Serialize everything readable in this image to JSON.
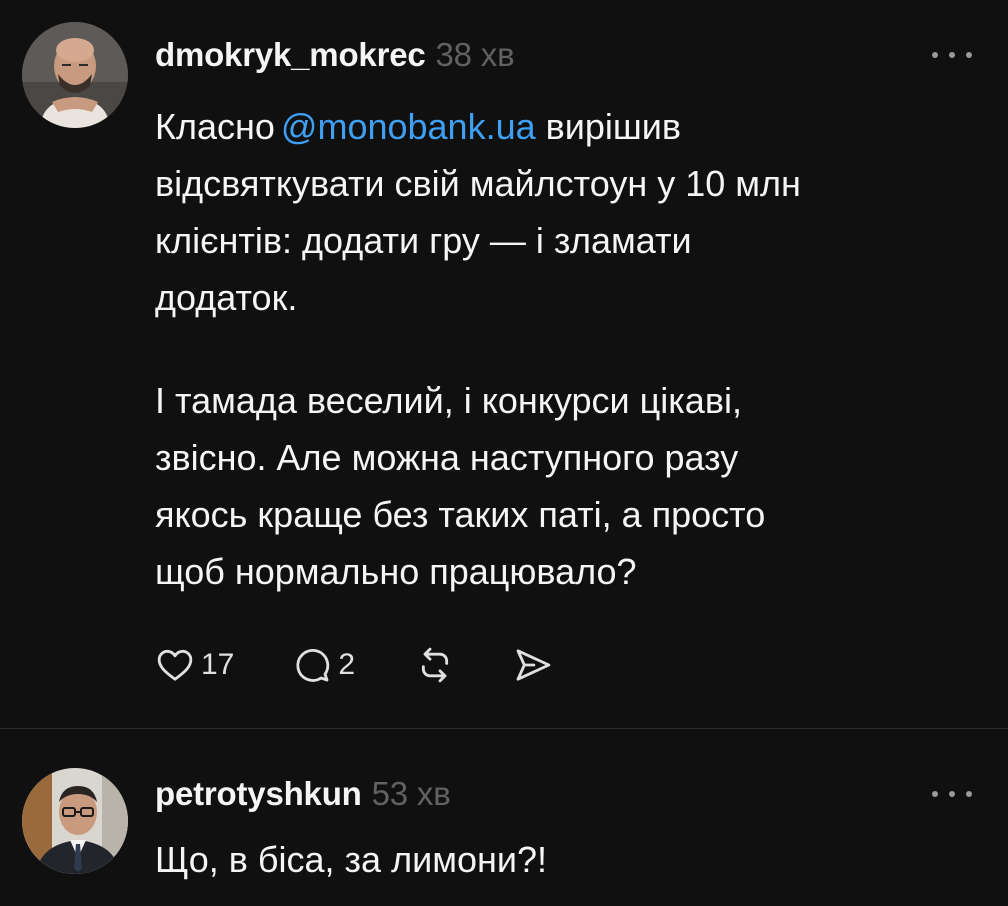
{
  "posts": [
    {
      "username": "dmokryk_mokrec",
      "time": "38 хв",
      "avatar_icon": "bald-man-avatar",
      "text": {
        "prefix": "Класно",
        "mention": "@monobank.ua",
        "line1_suffix": " вирішив",
        "line2": "відсвяткувати свій майлстоун у 10 млн",
        "line3": "клієнтів: додати гру — і зламати",
        "line4": "додаток.",
        "p2_line1": "І тамада веселий, і конкурси цікаві,",
        "p2_line2": "звісно. Але можна наступного разу",
        "p2_line3": "якось краще без таких паті, а просто",
        "p2_line4": "щоб нормально працювало?"
      },
      "likes": "17",
      "replies": "2"
    },
    {
      "username": "petrotyshkun",
      "time": "53 хв",
      "avatar_icon": "man-with-glasses-avatar",
      "text": "Що, в біса, за лимони?!"
    }
  ],
  "colors": {
    "background": "#101010",
    "text": "#f3f5f7",
    "muted": "#616161",
    "mention": "#3e9ff3"
  }
}
